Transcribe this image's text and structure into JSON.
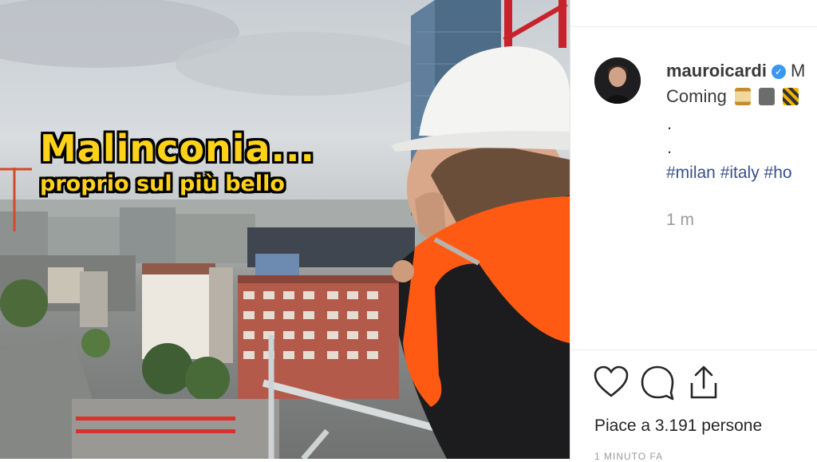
{
  "post": {
    "username": "mauroicardi",
    "username_tail": "M",
    "caption_text": "Coming",
    "dots": [
      ".",
      "."
    ],
    "hashtags": "#milan #italy #ho",
    "time_ago": "1 m",
    "likes_text": "Piace a 3.191 persone",
    "timestamp": "1 MINUTO FA"
  },
  "overlay": {
    "line1": "Malinconia...",
    "line2": "proprio sul più bello"
  },
  "actions": [
    "heart-icon",
    "comment-icon",
    "share-icon"
  ],
  "colors": {
    "caption_yellow": "#ffd21a",
    "verified_blue": "#3897f0",
    "hashtag_blue": "#385185",
    "vest_orange": "#ff5a14"
  }
}
